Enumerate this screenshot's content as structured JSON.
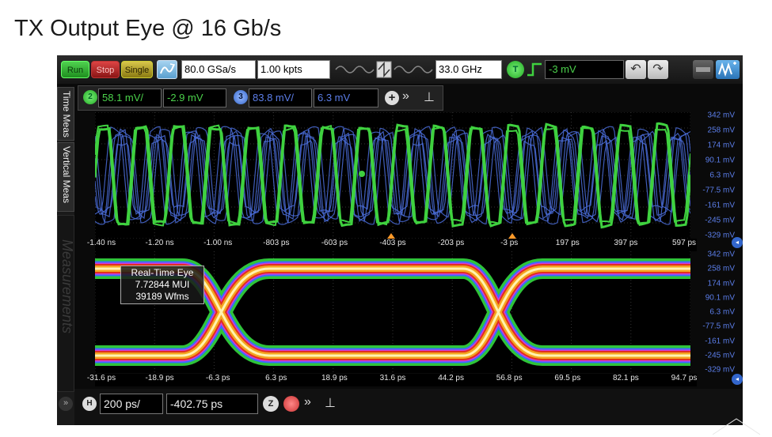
{
  "slide": {
    "title": "TX Output Eye @ 16 Gb/s"
  },
  "toolbar": {
    "run_label": "Run",
    "stop_label": "Stop",
    "single_label": "Single",
    "sample_rate": "80.0 GSa/s",
    "points": "1.00 kpts",
    "bandwidth": "33.0 GHz",
    "trigger_label": "T",
    "trigger_level": "-3 mV",
    "undo_icon": "undo-icon",
    "redo_icon": "redo-icon"
  },
  "channels": {
    "ch2": {
      "label": "2",
      "scale": "58.1 mV/",
      "offset": "-2.9 mV",
      "color": "#3fd13f"
    },
    "ch3": {
      "label": "3",
      "scale": "83.8 mV/",
      "offset": "6.3 mV",
      "color": "#4a6cd8"
    }
  },
  "sidebar": {
    "tab_time": "Time Meas",
    "tab_vertical": "Vertical Meas",
    "tab_measurements": "Measurements"
  },
  "waveform_plot": {
    "x_ticks": [
      "-1.40 ns",
      "-1.20 ns",
      "-1.00 ns",
      "-803 ps",
      "-603 ps",
      "-403 ps",
      "-203 ps",
      "-3 ps",
      "197 ps",
      "397 ps",
      "597 ps"
    ],
    "y_ticks": [
      "342 mV",
      "258 mV",
      "174 mV",
      "90.1 mV",
      "6.3 mV",
      "-77.5 mV",
      "-161 mV",
      "-245 mV",
      "-329 mV"
    ],
    "bit_rate_gbps": 16
  },
  "eye_plot": {
    "x_ticks": [
      "-31.6 ps",
      "-18.9 ps",
      "-6.3 ps",
      "6.3 ps",
      "18.9 ps",
      "31.6 ps",
      "44.2 ps",
      "56.8 ps",
      "69.5 ps",
      "82.1 ps",
      "94.7 ps"
    ],
    "y_ticks": [
      "342 mV",
      "258 mV",
      "174 mV",
      "90.1 mV",
      "6.3 mV",
      "-77.5 mV",
      "-161 mV",
      "-245 mV",
      "-329 mV"
    ],
    "legend": {
      "title": "Real-Time Eye",
      "mui": "7.72844 MUI",
      "wfms": "39189 Wfms"
    }
  },
  "timebase": {
    "h_label": "H",
    "scale": "200 ps/",
    "position": "-402.75 ps",
    "zoom_label": "Z"
  }
}
